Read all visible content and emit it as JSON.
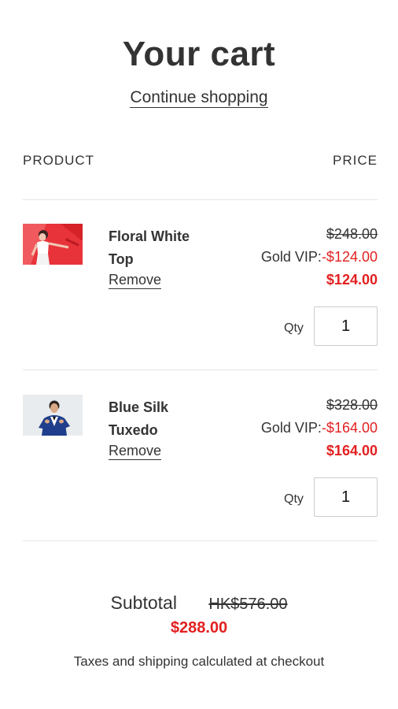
{
  "header": {
    "title": "Your cart",
    "continue_link": "Continue shopping"
  },
  "columns": {
    "product": "PRODUCT",
    "price": "PRICE"
  },
  "items": [
    {
      "name": "Floral White Top",
      "remove_label": "Remove",
      "original_price": "$248.00",
      "vip_label": "Gold VIP:",
      "vip_discount": "-$124.00",
      "final_price": "$124.00",
      "qty_label": "Qty",
      "qty_value": "1"
    },
    {
      "name": "Blue Silk Tuxedo",
      "remove_label": "Remove",
      "original_price": "$328.00",
      "vip_label": "Gold VIP:",
      "vip_discount": "-$164.00",
      "final_price": "$164.00",
      "qty_label": "Qty",
      "qty_value": "1"
    }
  ],
  "summary": {
    "subtotal_label": "Subtotal",
    "subtotal_original": "HK$576.00",
    "subtotal_final": "$288.00",
    "tax_note": "Taxes and shipping calculated at checkout"
  },
  "colors": {
    "accent_red": "#e22020",
    "text": "#333333"
  }
}
